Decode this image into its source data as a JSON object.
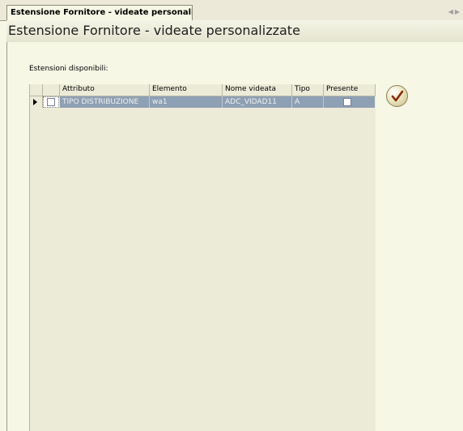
{
  "tab": {
    "label": "Estensione Fornitore - videate personalizzate"
  },
  "header": {
    "title": "Estensione Fornitore - videate personalizzate"
  },
  "section": {
    "label": "Estensioni disponibili:"
  },
  "grid": {
    "columns": [
      "Attributo",
      "Elemento",
      "Nome videata",
      "Tipo",
      "Presente"
    ],
    "rows": [
      {
        "attributo": "TIPO DISTRIBUZIONE",
        "elemento": "wa1",
        "nome_videata": "ADC_VIDAD11",
        "tipo": "A",
        "presente": false,
        "selected": false
      }
    ]
  },
  "icons": {
    "confirm": "checkmark-icon",
    "row_indicator": "row-pointer-icon",
    "tab_nav": "arrow-left-right-icon"
  },
  "colors": {
    "background": "#f7f7e6",
    "selection": "#8ea0b4",
    "checkmark": "#8a2b00"
  }
}
